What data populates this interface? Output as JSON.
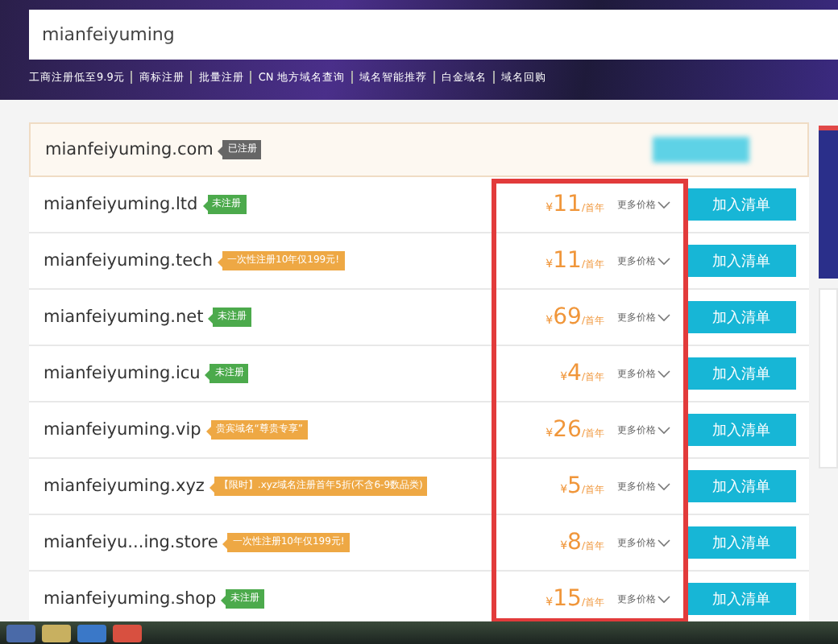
{
  "search": {
    "value": "mianfeiyuming"
  },
  "nav_links": [
    "工商注册低至9.9元",
    "商标注册",
    "批量注册",
    "CN 地方域名查询",
    "域名智能推荐",
    "白金域名",
    "域名回购"
  ],
  "results": [
    {
      "domain": "mianfeiyuming.com",
      "tag": {
        "kind": "registered",
        "text": "已注册"
      }
    },
    {
      "domain": "mianfeiyuming.ltd",
      "tag": {
        "kind": "available",
        "text": "未注册"
      },
      "currency": "¥",
      "price": "11",
      "unit": "/首年",
      "more": "更多价格",
      "action": "加入清单"
    },
    {
      "domain": "mianfeiyuming.tech",
      "tag": {
        "kind": "promo",
        "text": "一次性注册10年仅199元!"
      },
      "currency": "¥",
      "price": "11",
      "unit": "/首年",
      "more": "更多价格",
      "action": "加入清单"
    },
    {
      "domain": "mianfeiyuming.net",
      "tag": {
        "kind": "available",
        "text": "未注册"
      },
      "currency": "¥",
      "price": "69",
      "unit": "/首年",
      "more": "更多价格",
      "action": "加入清单"
    },
    {
      "domain": "mianfeiyuming.icu",
      "tag": {
        "kind": "available",
        "text": "未注册"
      },
      "currency": "¥",
      "price": "4",
      "unit": "/首年",
      "more": "更多价格",
      "action": "加入清单"
    },
    {
      "domain": "mianfeiyuming.vip",
      "tag": {
        "kind": "promo",
        "text": "贵宾域名“尊贵专享”"
      },
      "currency": "¥",
      "price": "26",
      "unit": "/首年",
      "more": "更多价格",
      "action": "加入清单"
    },
    {
      "domain": "mianfeiyuming.xyz",
      "tag": {
        "kind": "promo",
        "text": "【限时】.xyz域名注册首年5折(不含6-9数品类)"
      },
      "currency": "¥",
      "price": "5",
      "unit": "/首年",
      "more": "更多价格",
      "action": "加入清单"
    },
    {
      "domain": "mianfeiyu...ing.store",
      "tag": {
        "kind": "promo",
        "text": "一次性注册10年仅199元!"
      },
      "currency": "¥",
      "price": "8",
      "unit": "/首年",
      "more": "更多价格",
      "action": "加入清单"
    },
    {
      "domain": "mianfeiyuming.shop",
      "tag": {
        "kind": "available",
        "text": "未注册"
      },
      "currency": "¥",
      "price": "15",
      "unit": "/首年",
      "more": "更多价格",
      "action": "加入清单"
    }
  ]
}
